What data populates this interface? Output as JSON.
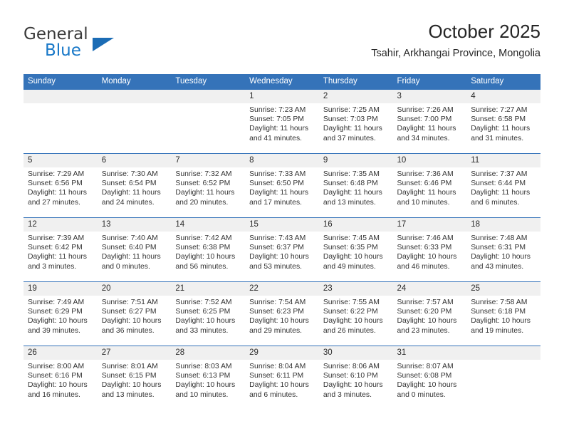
{
  "logo": {
    "word_top": "General",
    "word_bottom": "Blue",
    "triangle_color": "#1B6CB5",
    "blue_color": "#1878C8"
  },
  "header": {
    "title": "October 2025",
    "subtitle": "Tsahir, Arkhangai Province, Mongolia"
  },
  "theme": {
    "header_bg": "#3573B9",
    "daynum_bg": "#f0f0f0",
    "rule_color": "#3573B9"
  },
  "weekdays": [
    "Sunday",
    "Monday",
    "Tuesday",
    "Wednesday",
    "Thursday",
    "Friday",
    "Saturday"
  ],
  "weeks": [
    [
      {
        "day": "",
        "empty": true
      },
      {
        "day": "",
        "empty": true
      },
      {
        "day": "",
        "empty": true
      },
      {
        "day": "1",
        "sunrise": "Sunrise: 7:23 AM",
        "sunset": "Sunset: 7:05 PM",
        "daylight1": "Daylight: 11 hours",
        "daylight2": "and 41 minutes."
      },
      {
        "day": "2",
        "sunrise": "Sunrise: 7:25 AM",
        "sunset": "Sunset: 7:03 PM",
        "daylight1": "Daylight: 11 hours",
        "daylight2": "and 37 minutes."
      },
      {
        "day": "3",
        "sunrise": "Sunrise: 7:26 AM",
        "sunset": "Sunset: 7:00 PM",
        "daylight1": "Daylight: 11 hours",
        "daylight2": "and 34 minutes."
      },
      {
        "day": "4",
        "sunrise": "Sunrise: 7:27 AM",
        "sunset": "Sunset: 6:58 PM",
        "daylight1": "Daylight: 11 hours",
        "daylight2": "and 31 minutes."
      }
    ],
    [
      {
        "day": "5",
        "sunrise": "Sunrise: 7:29 AM",
        "sunset": "Sunset: 6:56 PM",
        "daylight1": "Daylight: 11 hours",
        "daylight2": "and 27 minutes."
      },
      {
        "day": "6",
        "sunrise": "Sunrise: 7:30 AM",
        "sunset": "Sunset: 6:54 PM",
        "daylight1": "Daylight: 11 hours",
        "daylight2": "and 24 minutes."
      },
      {
        "day": "7",
        "sunrise": "Sunrise: 7:32 AM",
        "sunset": "Sunset: 6:52 PM",
        "daylight1": "Daylight: 11 hours",
        "daylight2": "and 20 minutes."
      },
      {
        "day": "8",
        "sunrise": "Sunrise: 7:33 AM",
        "sunset": "Sunset: 6:50 PM",
        "daylight1": "Daylight: 11 hours",
        "daylight2": "and 17 minutes."
      },
      {
        "day": "9",
        "sunrise": "Sunrise: 7:35 AM",
        "sunset": "Sunset: 6:48 PM",
        "daylight1": "Daylight: 11 hours",
        "daylight2": "and 13 minutes."
      },
      {
        "day": "10",
        "sunrise": "Sunrise: 7:36 AM",
        "sunset": "Sunset: 6:46 PM",
        "daylight1": "Daylight: 11 hours",
        "daylight2": "and 10 minutes."
      },
      {
        "day": "11",
        "sunrise": "Sunrise: 7:37 AM",
        "sunset": "Sunset: 6:44 PM",
        "daylight1": "Daylight: 11 hours",
        "daylight2": "and 6 minutes."
      }
    ],
    [
      {
        "day": "12",
        "sunrise": "Sunrise: 7:39 AM",
        "sunset": "Sunset: 6:42 PM",
        "daylight1": "Daylight: 11 hours",
        "daylight2": "and 3 minutes."
      },
      {
        "day": "13",
        "sunrise": "Sunrise: 7:40 AM",
        "sunset": "Sunset: 6:40 PM",
        "daylight1": "Daylight: 11 hours",
        "daylight2": "and 0 minutes."
      },
      {
        "day": "14",
        "sunrise": "Sunrise: 7:42 AM",
        "sunset": "Sunset: 6:38 PM",
        "daylight1": "Daylight: 10 hours",
        "daylight2": "and 56 minutes."
      },
      {
        "day": "15",
        "sunrise": "Sunrise: 7:43 AM",
        "sunset": "Sunset: 6:37 PM",
        "daylight1": "Daylight: 10 hours",
        "daylight2": "and 53 minutes."
      },
      {
        "day": "16",
        "sunrise": "Sunrise: 7:45 AM",
        "sunset": "Sunset: 6:35 PM",
        "daylight1": "Daylight: 10 hours",
        "daylight2": "and 49 minutes."
      },
      {
        "day": "17",
        "sunrise": "Sunrise: 7:46 AM",
        "sunset": "Sunset: 6:33 PM",
        "daylight1": "Daylight: 10 hours",
        "daylight2": "and 46 minutes."
      },
      {
        "day": "18",
        "sunrise": "Sunrise: 7:48 AM",
        "sunset": "Sunset: 6:31 PM",
        "daylight1": "Daylight: 10 hours",
        "daylight2": "and 43 minutes."
      }
    ],
    [
      {
        "day": "19",
        "sunrise": "Sunrise: 7:49 AM",
        "sunset": "Sunset: 6:29 PM",
        "daylight1": "Daylight: 10 hours",
        "daylight2": "and 39 minutes."
      },
      {
        "day": "20",
        "sunrise": "Sunrise: 7:51 AM",
        "sunset": "Sunset: 6:27 PM",
        "daylight1": "Daylight: 10 hours",
        "daylight2": "and 36 minutes."
      },
      {
        "day": "21",
        "sunrise": "Sunrise: 7:52 AM",
        "sunset": "Sunset: 6:25 PM",
        "daylight1": "Daylight: 10 hours",
        "daylight2": "and 33 minutes."
      },
      {
        "day": "22",
        "sunrise": "Sunrise: 7:54 AM",
        "sunset": "Sunset: 6:23 PM",
        "daylight1": "Daylight: 10 hours",
        "daylight2": "and 29 minutes."
      },
      {
        "day": "23",
        "sunrise": "Sunrise: 7:55 AM",
        "sunset": "Sunset: 6:22 PM",
        "daylight1": "Daylight: 10 hours",
        "daylight2": "and 26 minutes."
      },
      {
        "day": "24",
        "sunrise": "Sunrise: 7:57 AM",
        "sunset": "Sunset: 6:20 PM",
        "daylight1": "Daylight: 10 hours",
        "daylight2": "and 23 minutes."
      },
      {
        "day": "25",
        "sunrise": "Sunrise: 7:58 AM",
        "sunset": "Sunset: 6:18 PM",
        "daylight1": "Daylight: 10 hours",
        "daylight2": "and 19 minutes."
      }
    ],
    [
      {
        "day": "26",
        "sunrise": "Sunrise: 8:00 AM",
        "sunset": "Sunset: 6:16 PM",
        "daylight1": "Daylight: 10 hours",
        "daylight2": "and 16 minutes."
      },
      {
        "day": "27",
        "sunrise": "Sunrise: 8:01 AM",
        "sunset": "Sunset: 6:15 PM",
        "daylight1": "Daylight: 10 hours",
        "daylight2": "and 13 minutes."
      },
      {
        "day": "28",
        "sunrise": "Sunrise: 8:03 AM",
        "sunset": "Sunset: 6:13 PM",
        "daylight1": "Daylight: 10 hours",
        "daylight2": "and 10 minutes."
      },
      {
        "day": "29",
        "sunrise": "Sunrise: 8:04 AM",
        "sunset": "Sunset: 6:11 PM",
        "daylight1": "Daylight: 10 hours",
        "daylight2": "and 6 minutes."
      },
      {
        "day": "30",
        "sunrise": "Sunrise: 8:06 AM",
        "sunset": "Sunset: 6:10 PM",
        "daylight1": "Daylight: 10 hours",
        "daylight2": "and 3 minutes."
      },
      {
        "day": "31",
        "sunrise": "Sunrise: 8:07 AM",
        "sunset": "Sunset: 6:08 PM",
        "daylight1": "Daylight: 10 hours",
        "daylight2": "and 0 minutes."
      },
      {
        "day": "",
        "empty": true
      }
    ]
  ]
}
